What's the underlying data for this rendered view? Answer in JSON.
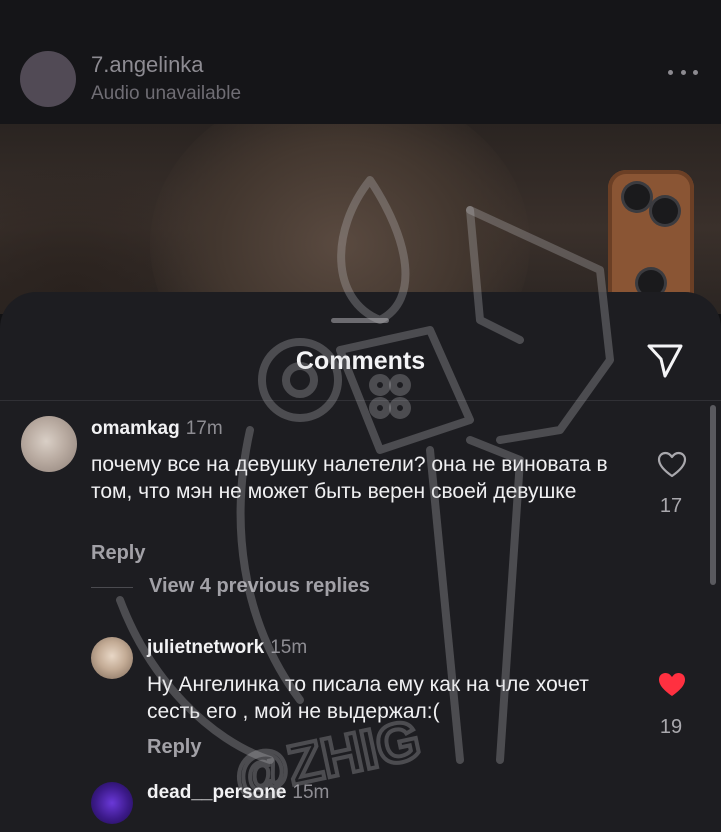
{
  "post": {
    "username": "7.angelinka",
    "audio_status": "Audio unavailable",
    "more_icon": "more-horizontal-icon"
  },
  "sheet": {
    "title": "Comments",
    "share_icon": "send-icon"
  },
  "comments": [
    {
      "username": "omamkag",
      "time": "17m",
      "text": "почему все на девушку налетели? она не виновата в том, что мэн не может быть верен своей девушке",
      "reply_label": "Reply",
      "likes": "17",
      "liked": false,
      "view_replies_label": "View 4 previous replies"
    },
    {
      "username": "julietnetwork",
      "time": "15m",
      "text": "Ну Ангелинка то писала ему как на члe хочет сесть его , мой не выдержал:(",
      "reply_label": "Reply",
      "likes": "19",
      "liked": true
    },
    {
      "username": "dead__persone",
      "time": "15m"
    }
  ],
  "watermark": {
    "text": "@ZHIG"
  },
  "colors": {
    "sheet_bg": "#1d1d21",
    "like_active": "#ff3040",
    "text_secondary": "#8e8d93"
  }
}
